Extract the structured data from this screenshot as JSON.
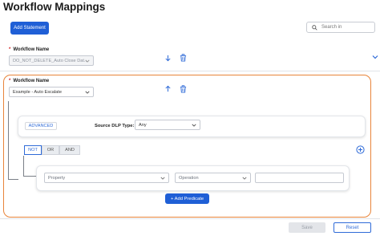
{
  "page": {
    "title": "Workflow Mappings"
  },
  "toolbar": {
    "add_statement_label": "Add Statement",
    "search_placeholder": "Search in"
  },
  "mapping1": {
    "label": "Workflow Name",
    "required_mark": "*",
    "selected_value": "DO_NOT_DELETE_Auto Close Dat..."
  },
  "mapping2": {
    "label": "Workflow Name",
    "required_mark": "*",
    "selected_value": "Example - Auto Escalate",
    "advanced_label": "ADVANCED",
    "source_dlp_label": "Source DLP Type:",
    "source_dlp_value": "Any",
    "logic_toggle": [
      "NOT",
      "OR",
      "AND"
    ],
    "predicate": {
      "property_placeholder": "Property",
      "operation_placeholder": "Operation",
      "value": ""
    },
    "add_predicate_label": "+ Add Predicate"
  },
  "footer": {
    "save_label": "Save",
    "reset_label": "Reset"
  },
  "colors": {
    "primary": "#1f5fd6",
    "focus_outline": "#e8843a",
    "required": "#d21d1d"
  },
  "icons": [
    "search-icon",
    "arrow-down-icon",
    "trash-icon",
    "chevron-down-icon",
    "arrow-up-icon",
    "plus-circle-icon"
  ]
}
